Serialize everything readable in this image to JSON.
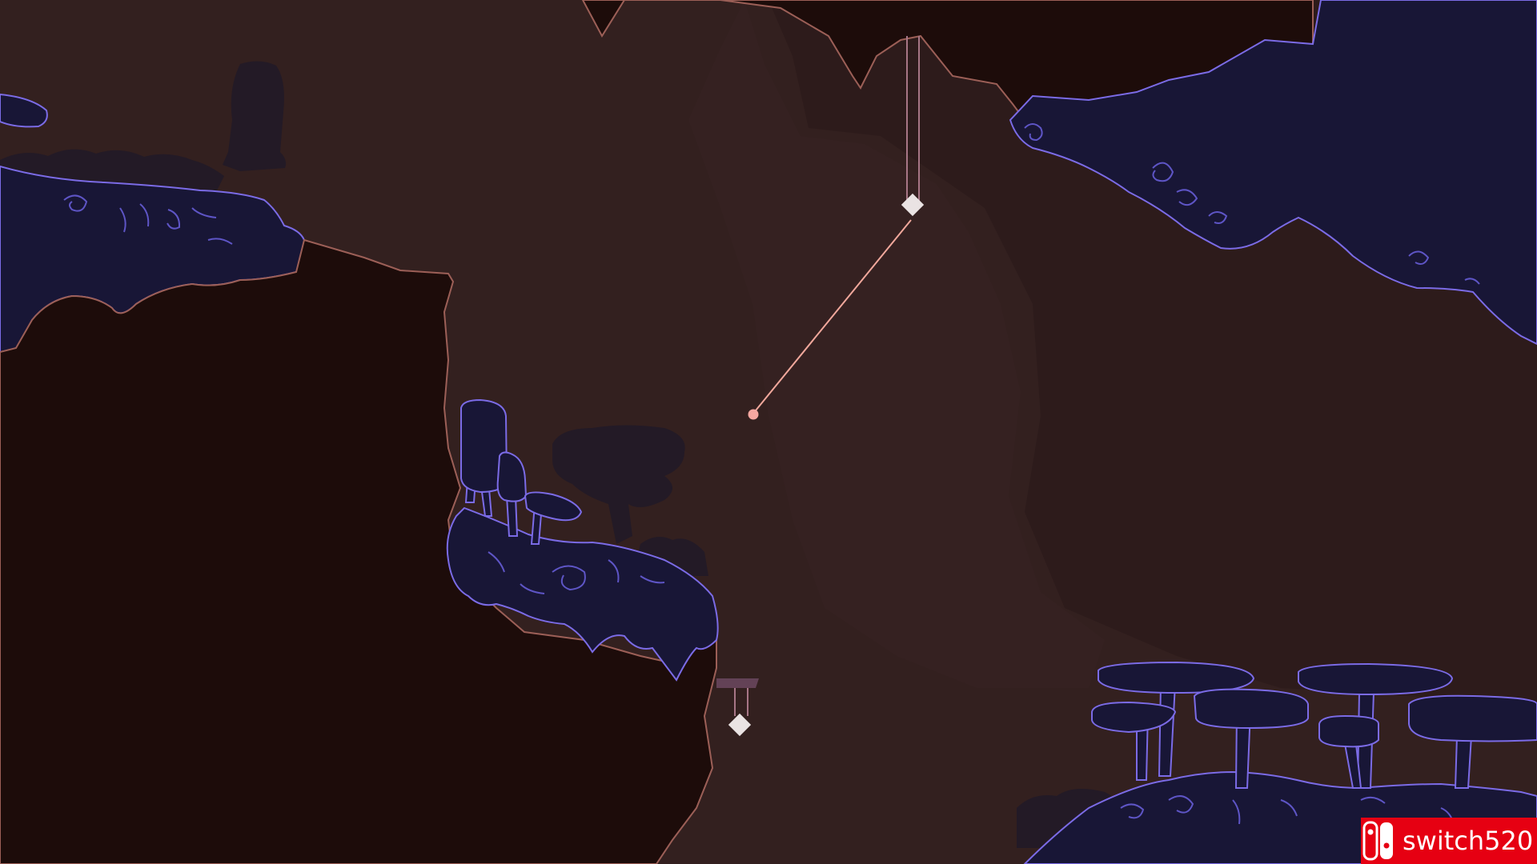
{
  "game": {
    "scene": "cave-mushroom-cliffs",
    "palette": {
      "background": "#33201f",
      "background_light": "#3a2625",
      "background_dark": "#2d1b1b",
      "cliff_fill": "#1d0c0a",
      "cliff_edge": "#9c5f57",
      "foliage_fill": "#181636",
      "foliage_edge": "#7b6be6",
      "silhouette": "#231a26",
      "grapple_line": "#f1a89c",
      "grapple_hook": "#f6a7a0",
      "anchor": "#eae3e3",
      "anchor_string": "#a77686",
      "hud_ledge": "#634256"
    },
    "grapple_active": true
  },
  "watermark": {
    "text": "switch520",
    "color": "#e60012",
    "icon": "nintendo-switch-icon"
  }
}
